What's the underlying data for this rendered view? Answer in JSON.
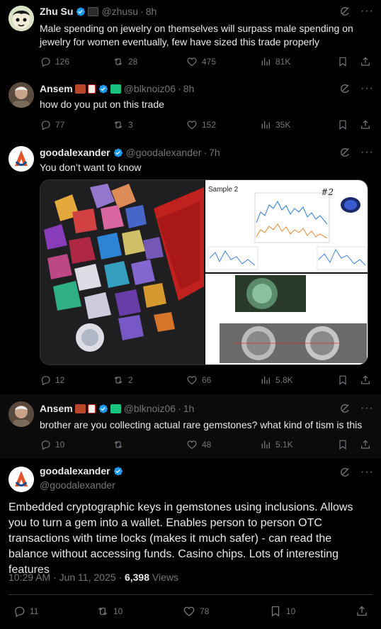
{
  "colors": {
    "bg": "#000000",
    "text": "#e7e9ea",
    "muted": "#71767b",
    "verified": "#1d9bf0",
    "divider": "#2f3336"
  },
  "tweets": [
    {
      "name": "Zhu Su",
      "handle": "@zhusu",
      "time": "8h",
      "text": "Male spending on jewelry on themselves will surpass male spending on jewelry for women eventually, few have sized this trade properly",
      "replies": "126",
      "reposts": "28",
      "likes": "475",
      "views": "81K"
    },
    {
      "name": "Ansem",
      "handle": "@blknoiz06",
      "time": "8h",
      "text": "how do you put on this trade",
      "replies": "77",
      "reposts": "3",
      "likes": "152",
      "views": "35K"
    },
    {
      "name": "goodalexander",
      "handle": "@goodalexander",
      "time": "7h",
      "text": "You don’t want to know",
      "replies": "12",
      "reposts": "2",
      "likes": "66",
      "views": "5.8K",
      "media": {
        "sample_label": "Sample 2",
        "tag": "#2"
      }
    },
    {
      "name": "Ansem",
      "handle": "@blknoiz06",
      "time": "1h",
      "text": "brother are you collecting actual rare gemstones? what kind of tism is this",
      "replies": "10",
      "reposts": "",
      "likes": "48",
      "views": "5.1K"
    }
  ],
  "detail": {
    "name": "goodalexander",
    "handle": "@goodalexander",
    "text": "Embedded cryptographic keys in gemstones using inclusions. Allows you to turn a gem into a wallet. Enables person to person OTC transactions with time locks (makes it much safer) - can read the balance without accessing funds. Casino chips. Lots of interesting features",
    "time": "10:29 AM · Jun 11, 2025 · ",
    "views_count": "6,398",
    "views_label": " Views",
    "replies": "11",
    "reposts": "10",
    "likes": "78",
    "bookmarks": "10"
  },
  "icons": [
    "verified-badge-icon",
    "grok-icon",
    "more-icon",
    "reply-icon",
    "repost-icon",
    "like-icon",
    "views-icon",
    "bookmark-icon",
    "share-icon"
  ]
}
